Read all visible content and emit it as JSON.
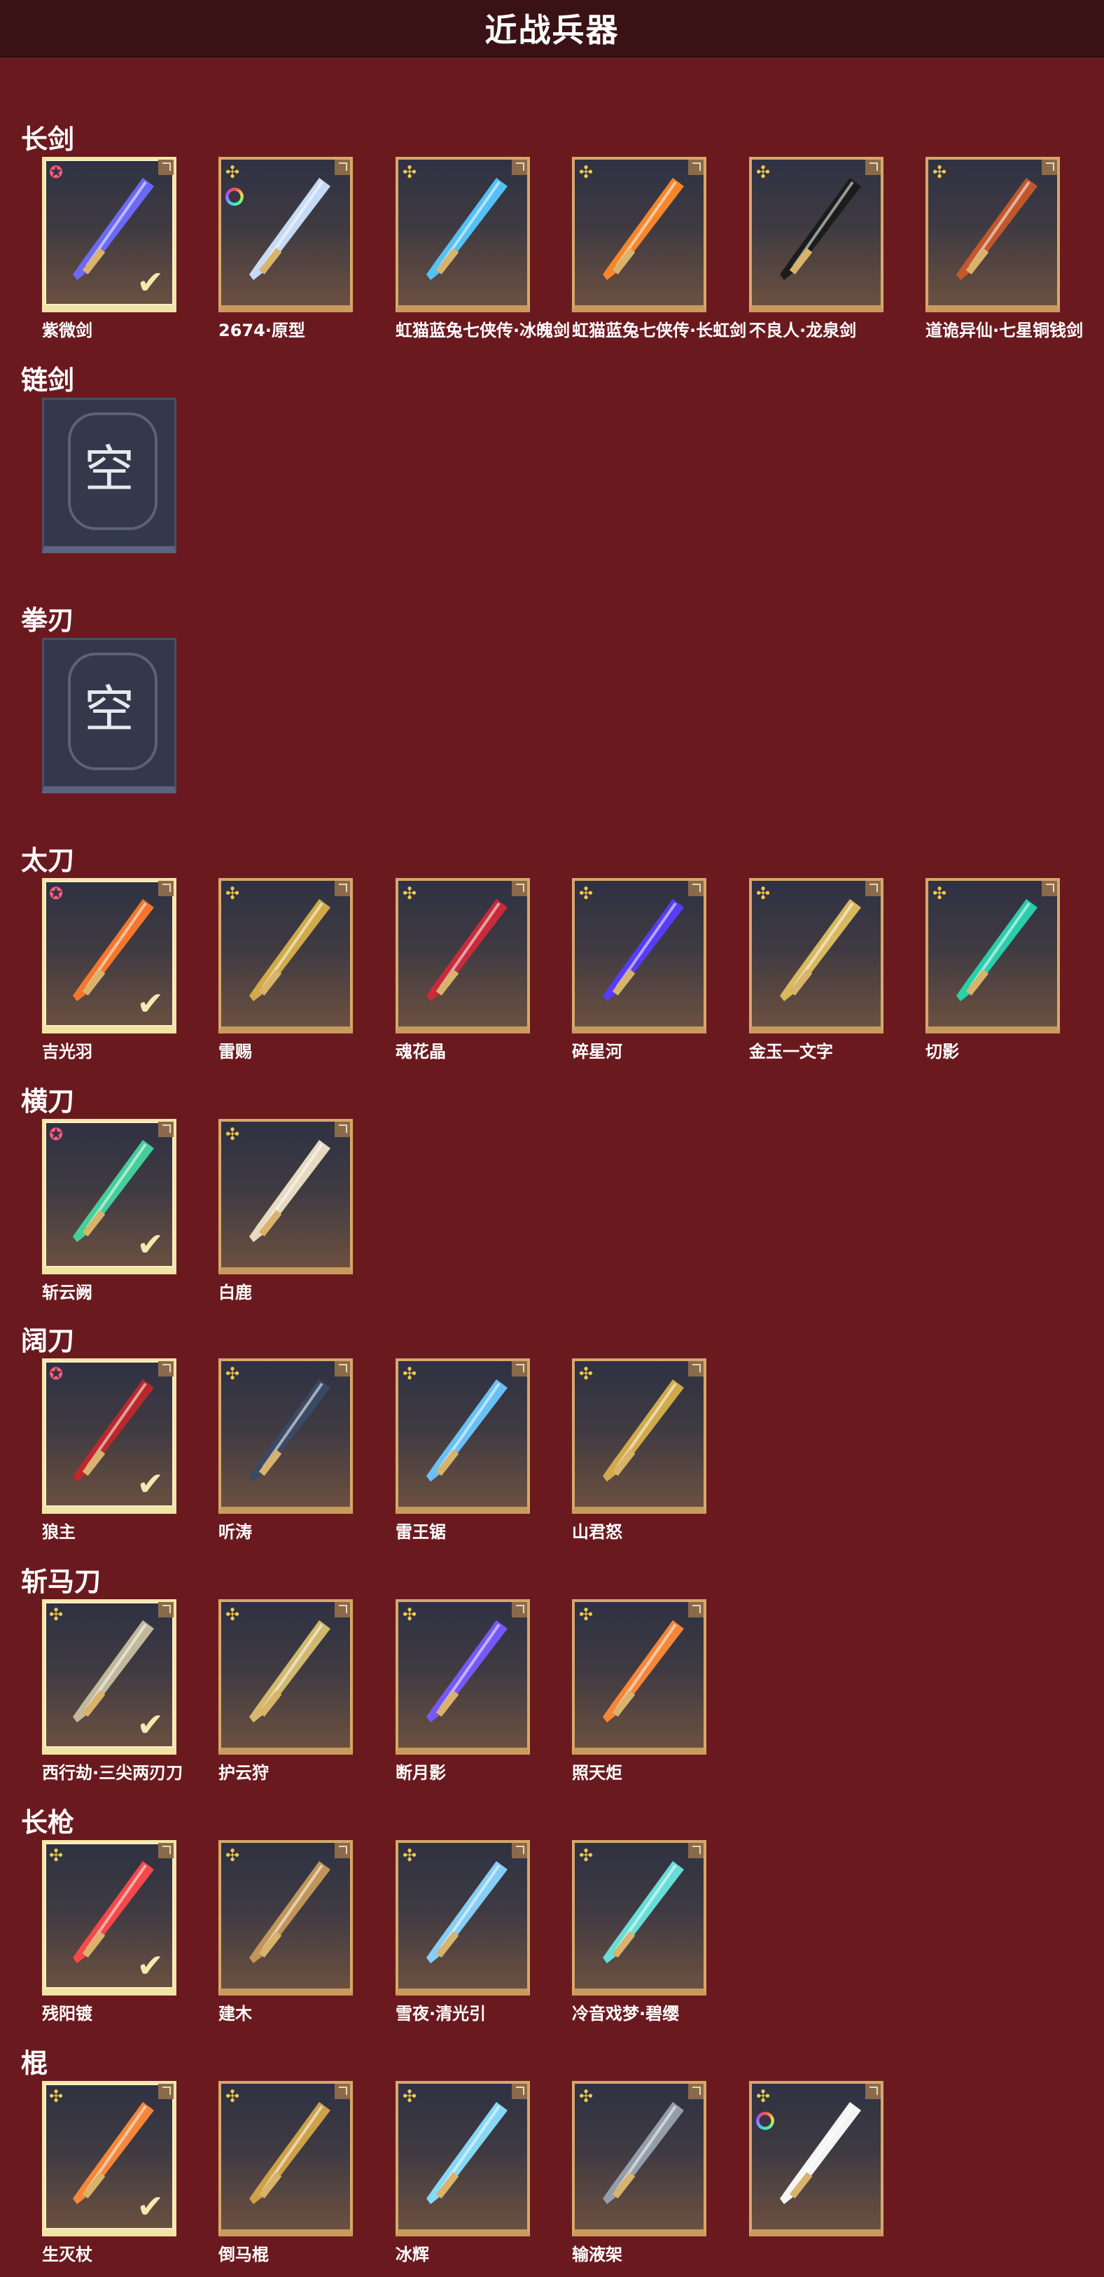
{
  "title": "近战兵器",
  "sections": [
    {
      "label": "长剑",
      "items": [
        {
          "name": "紫微剑",
          "badge": "star",
          "selected": true,
          "color": "#6f6cff"
        },
        {
          "name": "2674·原型",
          "badge": "flower",
          "selected": false,
          "color": "#cfe3ff",
          "ring": true
        },
        {
          "name": "虹猫蓝兔七侠传·冰魄剑",
          "badge": "flower",
          "selected": false,
          "color": "#55c8ff"
        },
        {
          "name": "虹猫蓝兔七侠传·长虹剑",
          "badge": "flower",
          "selected": false,
          "color": "#ff8a2a"
        },
        {
          "name": "不良人·龙泉剑",
          "badge": "flower",
          "selected": false,
          "color": "#1a1a1a"
        },
        {
          "name": "道诡异仙·七星铜钱剑",
          "badge": "flower",
          "selected": false,
          "color": "#c85a2a"
        }
      ]
    },
    {
      "label": "链剑",
      "items": [
        {
          "name": "",
          "empty": true,
          "empty_text": "空"
        }
      ]
    },
    {
      "label": "拳刃",
      "items": [
        {
          "name": "",
          "empty": true,
          "empty_text": "空"
        }
      ]
    },
    {
      "label": "太刀",
      "items": [
        {
          "name": "吉光羽",
          "badge": "star",
          "selected": true,
          "color": "#ff7a2a"
        },
        {
          "name": "雷赐",
          "badge": "flower",
          "selected": false,
          "color": "#d9b04a"
        },
        {
          "name": "魂花晶",
          "badge": "flower",
          "selected": false,
          "color": "#d02a3a"
        },
        {
          "name": "碎星河",
          "badge": "flower",
          "selected": false,
          "color": "#5a3cff"
        },
        {
          "name": "金玉一文字",
          "badge": "flower",
          "selected": false,
          "color": "#e0c060"
        },
        {
          "name": "切影",
          "badge": "flower",
          "selected": false,
          "color": "#2ad6b0"
        }
      ]
    },
    {
      "label": "横刀",
      "items": [
        {
          "name": "斩云阙",
          "badge": "star",
          "selected": true,
          "color": "#46d6a0"
        },
        {
          "name": "白鹿",
          "badge": "flower",
          "selected": false,
          "color": "#efe3c8"
        }
      ]
    },
    {
      "label": "阔刀",
      "items": [
        {
          "name": "狼主",
          "badge": "star",
          "selected": true,
          "color": "#c0282a"
        },
        {
          "name": "听涛",
          "badge": "flower",
          "selected": false,
          "color": "#3a4a66"
        },
        {
          "name": "雷王锯",
          "badge": "flower",
          "selected": false,
          "color": "#6ac8ff"
        },
        {
          "name": "山君怒",
          "badge": "flower",
          "selected": false,
          "color": "#d9b04a"
        }
      ]
    },
    {
      "label": "斩马刀",
      "items": [
        {
          "name": "西行劫·三尖两刃刀",
          "badge": "flower",
          "selected": true,
          "color": "#c8c0a0"
        },
        {
          "name": "护云狩",
          "badge": "flower",
          "selected": false,
          "color": "#d9c070"
        },
        {
          "name": "断月影",
          "badge": "flower",
          "selected": false,
          "color": "#7a5aff"
        },
        {
          "name": "照天炬",
          "badge": "flower",
          "selected": false,
          "color": "#ff8a3a"
        }
      ]
    },
    {
      "label": "长枪",
      "items": [
        {
          "name": "残阳镀",
          "badge": "flower",
          "selected": true,
          "color": "#ff4a4a"
        },
        {
          "name": "建木",
          "badge": "flower",
          "selected": false,
          "color": "#c89a5a"
        },
        {
          "name": "雪夜·清光引",
          "badge": "flower",
          "selected": false,
          "color": "#8ad6ff"
        },
        {
          "name": "冷音戏梦·碧缨",
          "badge": "flower",
          "selected": false,
          "color": "#6ae6e0"
        }
      ]
    },
    {
      "label": "棍",
      "items": [
        {
          "name": "生灭杖",
          "badge": "flower",
          "selected": true,
          "color": "#ff8a3a"
        },
        {
          "name": "倒马棍",
          "badge": "flower",
          "selected": false,
          "color": "#d6a64a"
        },
        {
          "name": "冰辉",
          "badge": "flower",
          "selected": false,
          "color": "#8ae0ff"
        },
        {
          "name": "输液架",
          "badge": "flower",
          "selected": false,
          "color": "#9aa2b0"
        },
        {
          "name": "",
          "badge": "flower",
          "selected": false,
          "color": "#ffffff",
          "ring": true
        }
      ]
    }
  ]
}
